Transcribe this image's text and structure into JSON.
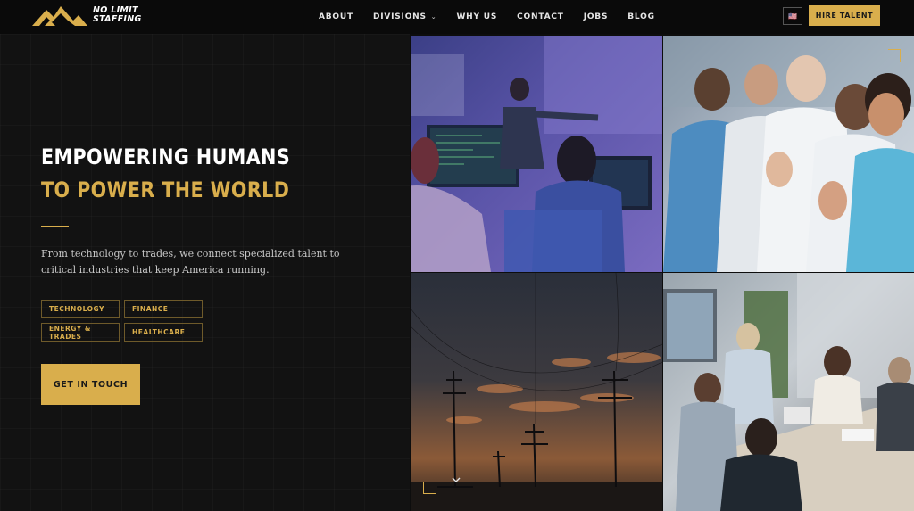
{
  "brand": {
    "line1": "NO LIMIT",
    "line2": "STAFFING",
    "accent": "#d9ae4c"
  },
  "nav": {
    "about": "ABOUT",
    "divisions": "DIVISIONS",
    "why_us": "WHY US",
    "contact": "CONTACT",
    "jobs": "JOBS",
    "blog": "BLOG"
  },
  "header": {
    "flag_label": "🇺🇸",
    "hire_label": "HIRE TALENT"
  },
  "hero": {
    "headline_1": "EMPOWERING HUMANS",
    "headline_2": "TO POWER THE WORLD",
    "lead": "From technology to trades, we connect specialized talent to critical industries that keep America running.",
    "tags": [
      "TECHNOLOGY",
      "FINANCE",
      "ENERGY & TRADES",
      "HEALTHCARE"
    ],
    "cta_label": "GET IN TOUCH"
  },
  "images": [
    {
      "icon": "tech-presentation-photo"
    },
    {
      "icon": "healthcare-applause-photo"
    },
    {
      "icon": "power-lines-sunset-photo"
    },
    {
      "icon": "office-meeting-photo"
    }
  ]
}
